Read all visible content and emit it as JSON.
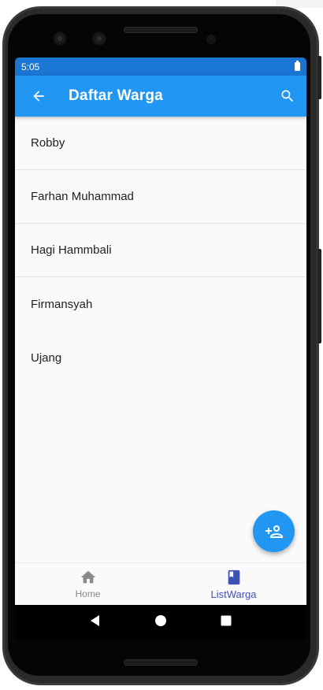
{
  "status_bar": {
    "time": "5:05"
  },
  "app_bar": {
    "title": "Daftar Warga",
    "back_icon": "arrow-back-icon",
    "search_icon": "search-icon"
  },
  "list": {
    "items": [
      {
        "name": "Robby"
      },
      {
        "name": "Farhan Muhammad"
      },
      {
        "name": "Hagi Hammbali"
      },
      {
        "name": "Firmansyah"
      },
      {
        "name": "Ujang"
      }
    ]
  },
  "fab": {
    "icon": "person-add-icon"
  },
  "bottom_nav": {
    "items": [
      {
        "label": "Home",
        "icon": "home-icon",
        "active": false
      },
      {
        "label": "ListWarga",
        "icon": "book-icon",
        "active": true
      }
    ]
  },
  "colors": {
    "primary": "#2196f3",
    "primary_dark": "#1976d2",
    "active_nav": "#3f51b5",
    "background": "#fafafa"
  },
  "system_nav": {
    "icons": [
      "back-triangle-icon",
      "home-circle-icon",
      "recents-square-icon"
    ]
  }
}
